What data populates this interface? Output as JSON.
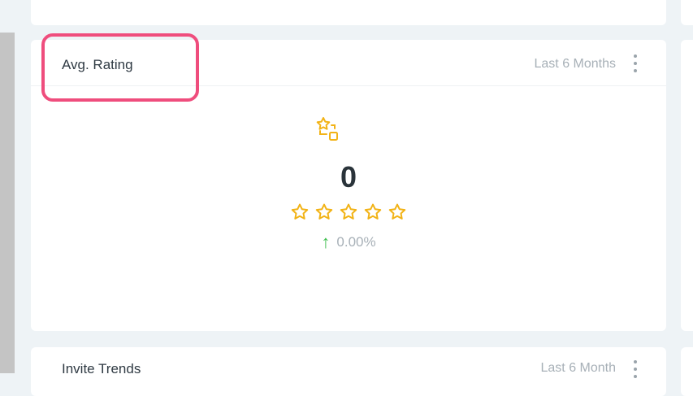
{
  "colors": {
    "accent_star": "#f2b316",
    "highlight": "#ef4d7d",
    "trend_up": "#3fbf4f"
  },
  "avg_rating_card": {
    "title": "Avg. Rating",
    "period": "Last 6 Months",
    "value": "0",
    "star_rating": 0,
    "star_count": 5,
    "trend_icon": "arrow-up-icon",
    "trend_value": "0.00%",
    "card_icon": "star-shapes-icon"
  },
  "invite_trends_card": {
    "title": "Invite Trends",
    "period": "Last 6 Month"
  }
}
